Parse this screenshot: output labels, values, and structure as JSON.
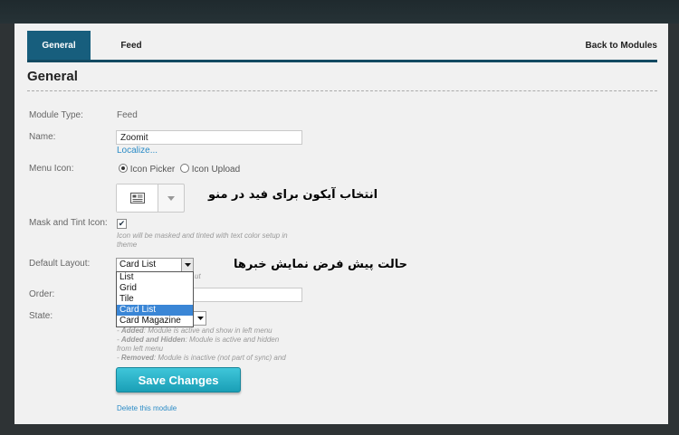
{
  "tabs": {
    "general_label": "General",
    "feed_label": "Feed",
    "back_label": "Back to Modules"
  },
  "page_title": "General",
  "form": {
    "module_type_label": "Module Type:",
    "module_type_value": "Feed",
    "name_label": "Name:",
    "name_value": "Zoomit",
    "localize_link": "Localize...",
    "menu_icon_label": "Menu Icon:",
    "icon_picker_option": "Icon Picker",
    "icon_upload_option": "Icon Upload",
    "icon_picker_selected": true,
    "mask_label": "Mask and Tint Icon:",
    "mask_checked": true,
    "mask_hint": "Icon will be masked and tinted with text color setup in theme",
    "default_layout_label": "Default Layout:",
    "default_layout_value": "Card List",
    "default_layout_options": [
      "List",
      "Grid",
      "Tile",
      "Card List",
      "Card Magazine"
    ],
    "layout_hint_fragment": "ut",
    "order_label": "Order:",
    "state_label": "State:",
    "state_hints": {
      "added_term": "Added",
      "added_text": ": Module is active and show in left menu",
      "added_hidden_term": "Added and Hidden",
      "added_hidden_text_line1": ": Module is active and hidden",
      "added_hidden_text_line2": "from left menu",
      "removed_term": "Removed",
      "removed_text": ": Module is inactive (not part of sync) and"
    },
    "save_button": "Save Changes",
    "delete_link": "Delete this module"
  },
  "annotations": {
    "icon_note": "انتخاب آیکون برای فید در منو",
    "layout_note": "حالت پیش فرض نمایش خبرها"
  },
  "colors": {
    "active_tab": "#175e7d",
    "tab_underline": "#134a62",
    "save_button": "#1fa9bf",
    "link": "#2a8bc6",
    "dropdown_selected": "#3a86d6"
  }
}
